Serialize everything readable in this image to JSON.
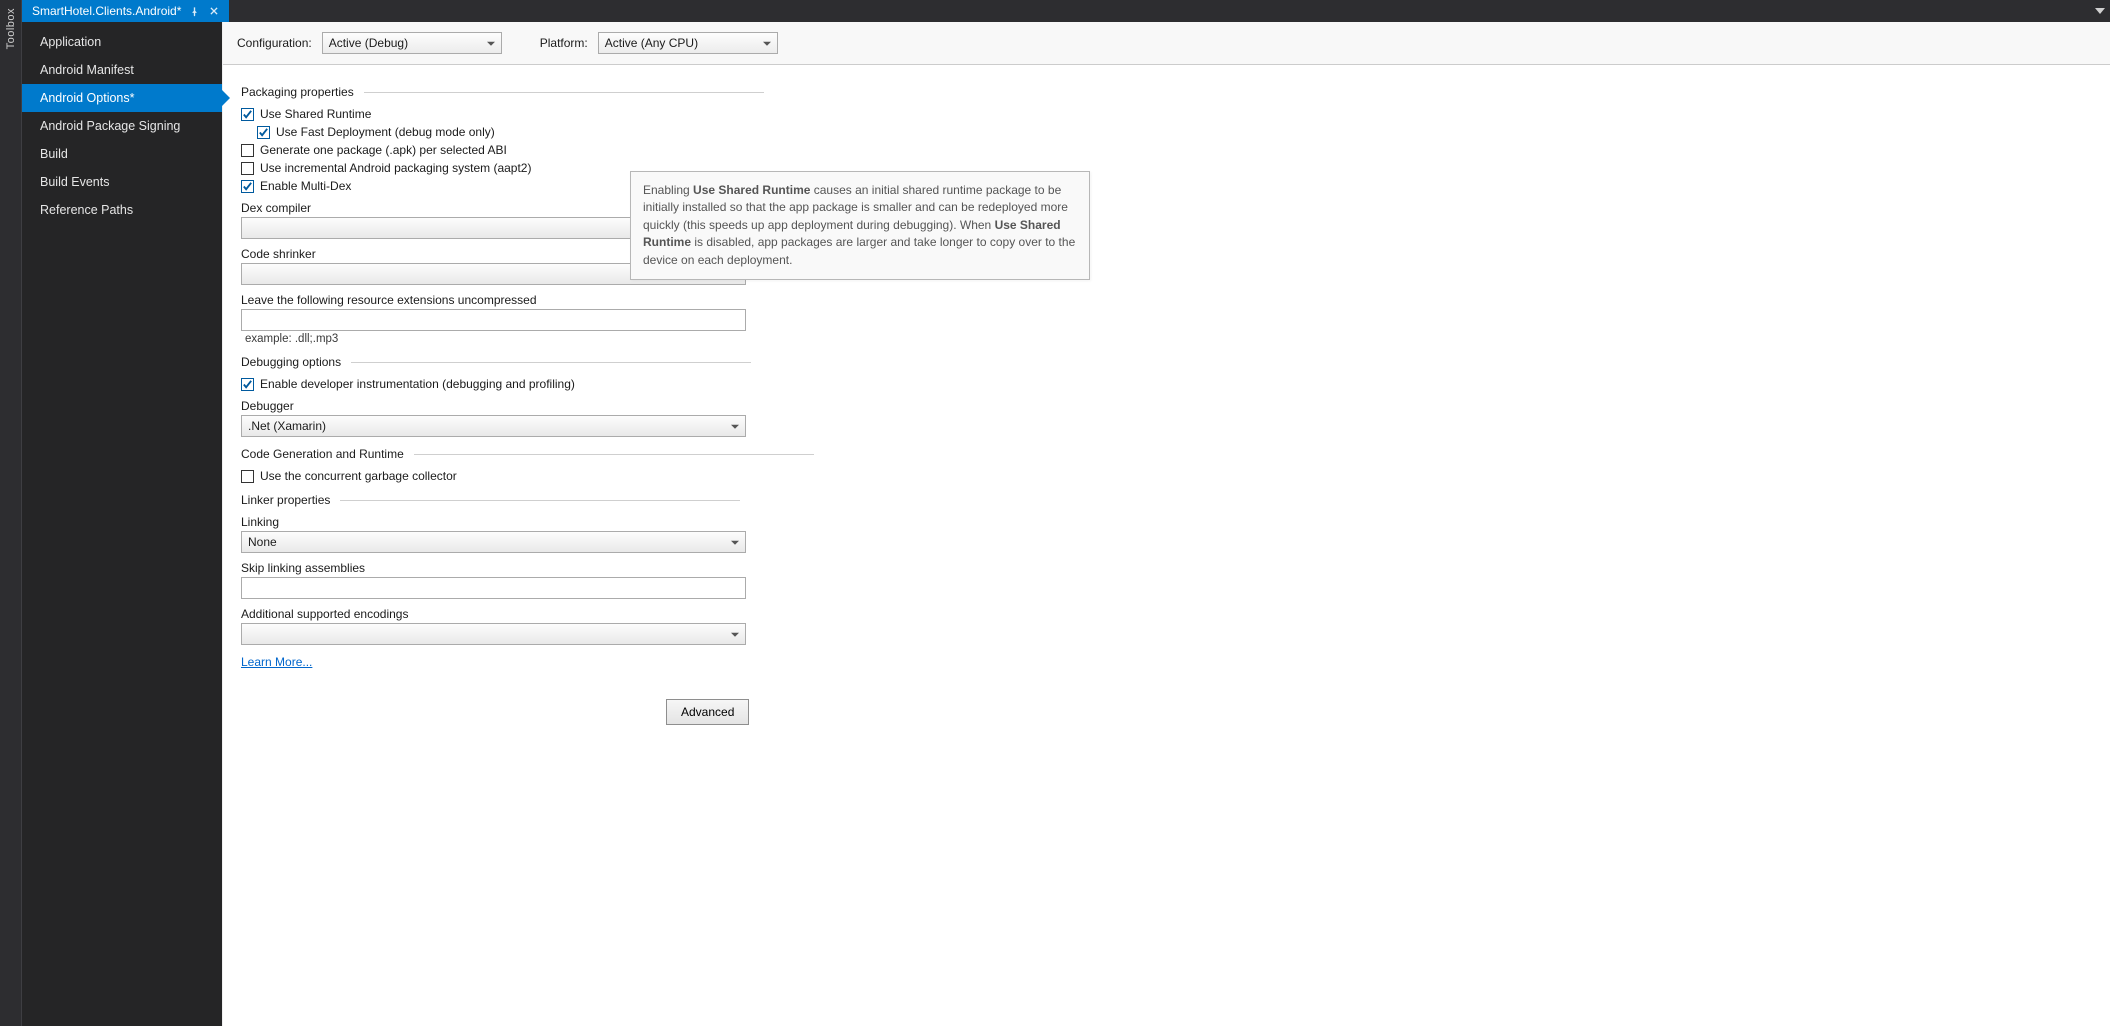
{
  "toolbox": {
    "label": "Toolbox"
  },
  "tab": {
    "title": "SmartHotel.Clients.Android*"
  },
  "sidebar": {
    "items": [
      {
        "label": "Application"
      },
      {
        "label": "Android Manifest"
      },
      {
        "label": "Android Options*"
      },
      {
        "label": "Android Package Signing"
      },
      {
        "label": "Build"
      },
      {
        "label": "Build Events"
      },
      {
        "label": "Reference Paths"
      }
    ],
    "selected_index": 2
  },
  "topbar": {
    "config_label": "Configuration:",
    "config_value": "Active (Debug)",
    "platform_label": "Platform:",
    "platform_value": "Active (Any CPU)"
  },
  "sections": {
    "packaging": {
      "title": "Packaging properties",
      "use_shared_runtime": "Use Shared Runtime",
      "use_fast_deploy": "Use Fast Deployment (debug mode only)",
      "gen_one_pkg": "Generate one package (.apk) per selected ABI",
      "incremental": "Use incremental Android packaging system (aapt2)",
      "multidex": "Enable Multi-Dex",
      "dex_label": "Dex compiler",
      "shrinker_label": "Code shrinker",
      "uncompressed_label": "Leave the following resource extensions uncompressed",
      "uncompressed_hint": "example: .dll;.mp3"
    },
    "debugging": {
      "title": "Debugging options",
      "instrumentation": "Enable developer instrumentation (debugging and profiling)",
      "debugger_label": "Debugger",
      "debugger_value": ".Net (Xamarin)"
    },
    "codegen": {
      "title": "Code Generation and Runtime",
      "concurrent_gc": "Use the concurrent garbage collector"
    },
    "linker": {
      "title": "Linker properties",
      "linking_label": "Linking",
      "linking_value": "None",
      "skip_label": "Skip linking assemblies",
      "encodings_label": "Additional supported encodings",
      "learn_more": "Learn More..."
    },
    "advanced_btn": "Advanced"
  },
  "tooltip": {
    "t1": "Enabling ",
    "b1": "Use Shared Runtime",
    "t2": " causes an initial shared runtime package to be initially installed so that the app package is smaller and can be redeployed more quickly (this speeds up app deployment during debugging). When ",
    "b2": "Use Shared Runtime",
    "t3": " is disabled, app packages are larger and take longer to copy over to the device on each deployment."
  }
}
